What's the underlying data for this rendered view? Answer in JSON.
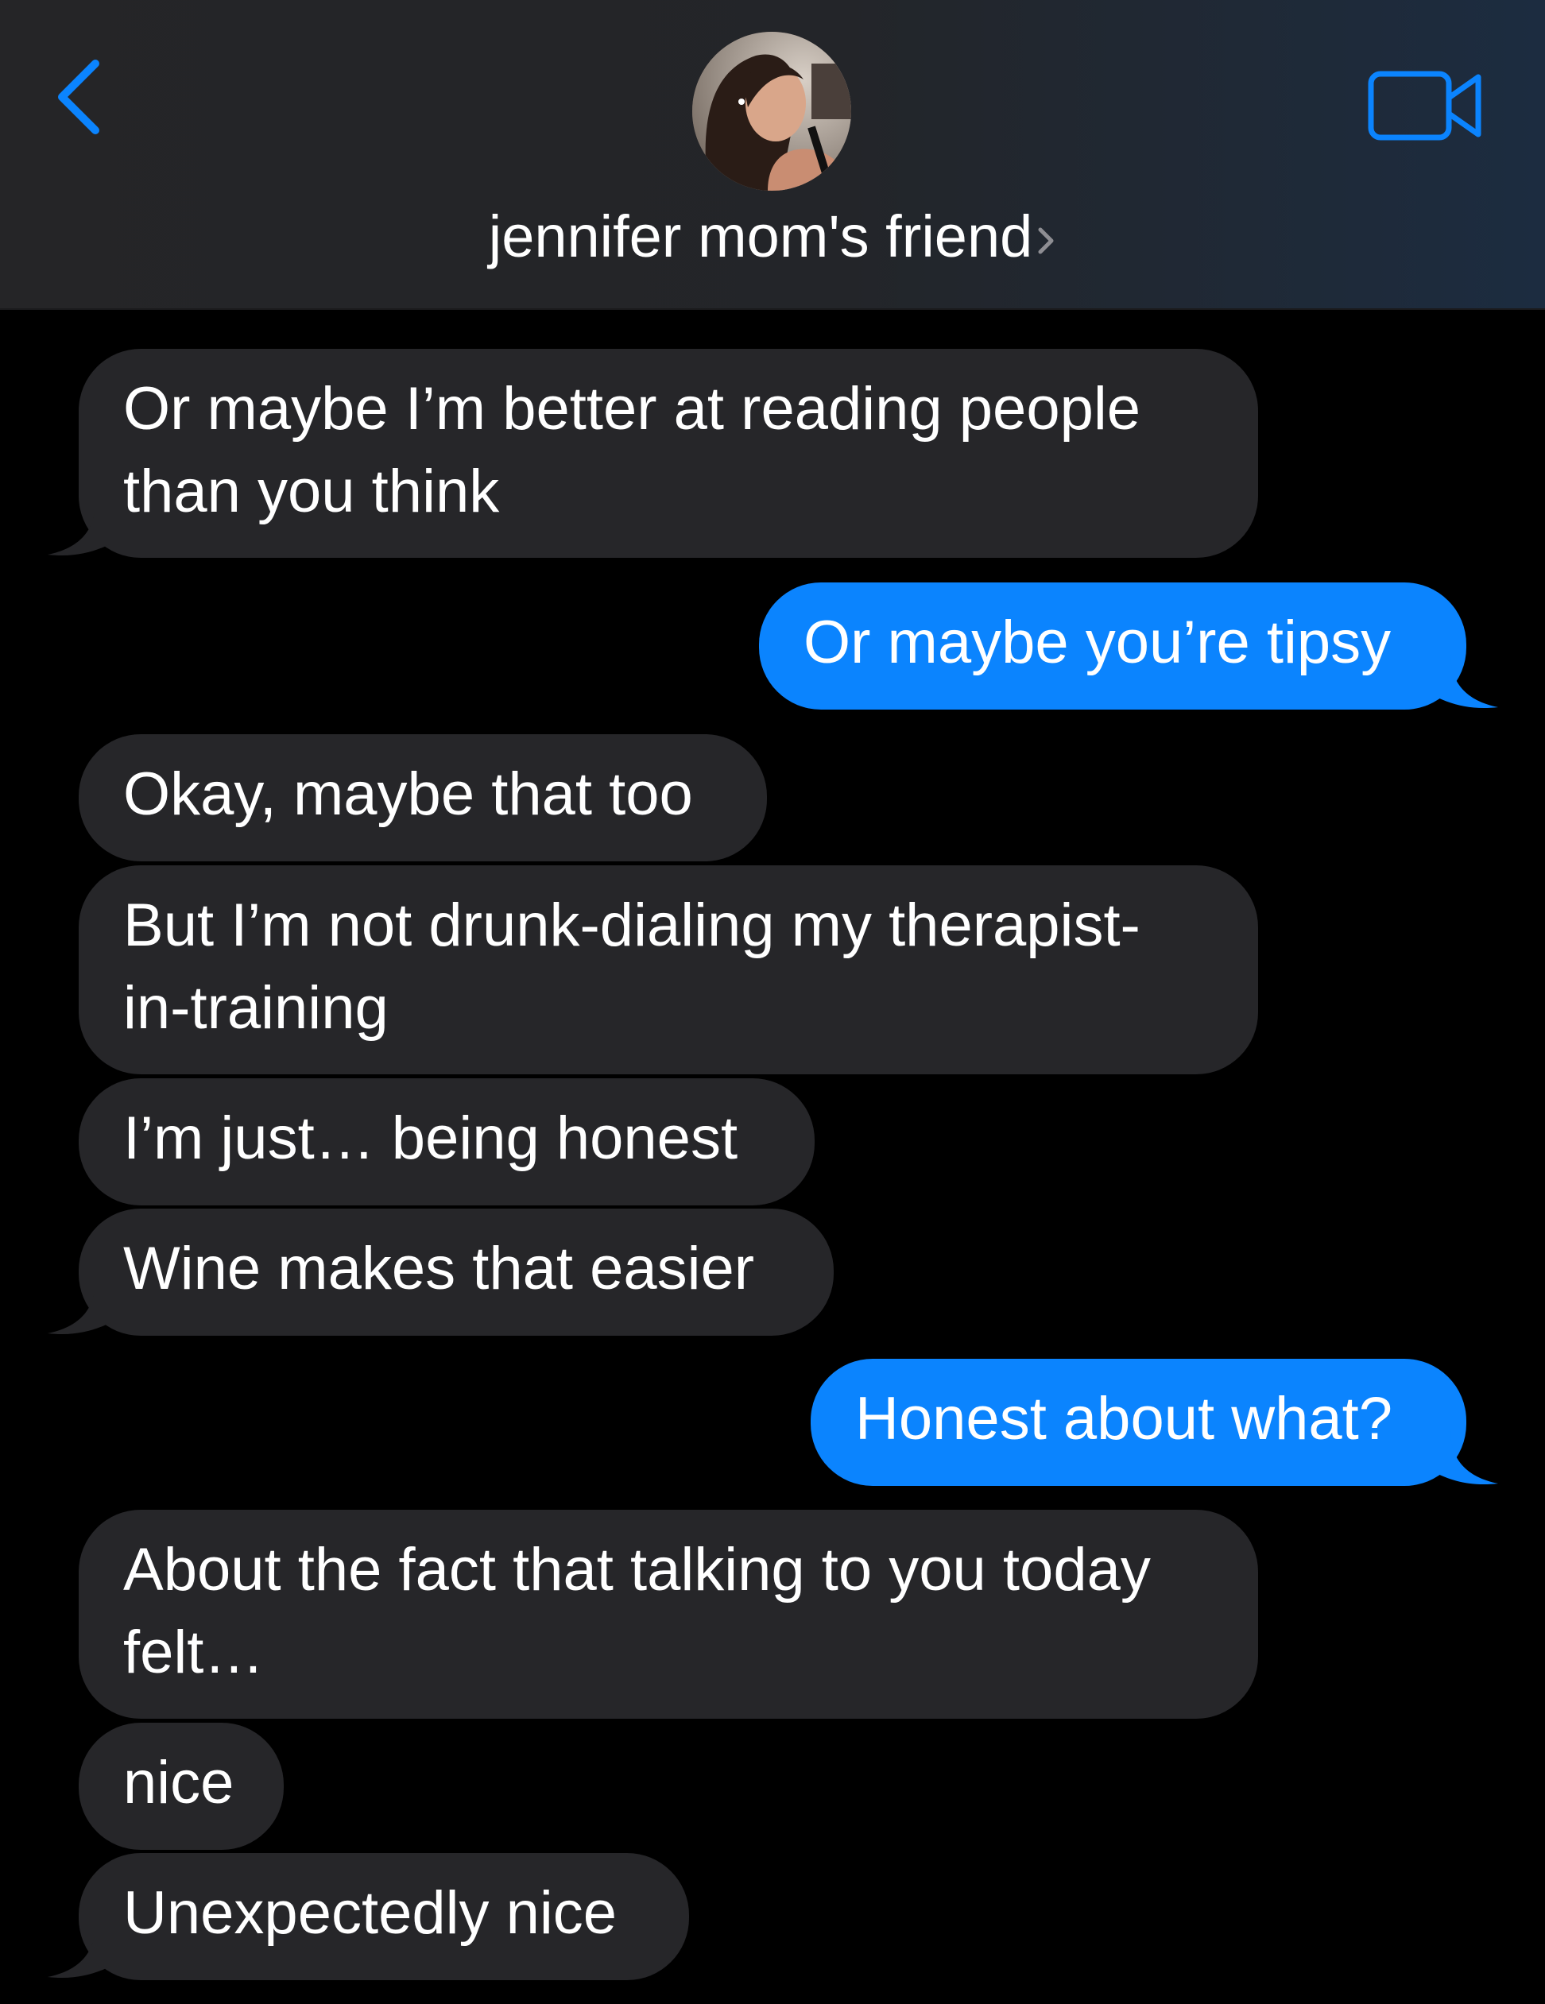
{
  "header": {
    "back_icon": "chevron-left-icon",
    "contact_name": "jennifer mom's friend",
    "video_icon": "video-camera-icon",
    "accent_color": "#0b84fe"
  },
  "messages": [
    {
      "side": "received",
      "lines": [
        "Or maybe I’m better at reading people",
        "than you think"
      ],
      "tail": true
    },
    {
      "side": "sent",
      "lines": [
        "Or maybe you’re tipsy"
      ],
      "tail": true
    },
    {
      "side": "received",
      "lines": [
        "Okay, maybe that too"
      ],
      "tail": false
    },
    {
      "side": "received",
      "lines": [
        "But I’m not drunk-dialing my therapist-",
        "in-training"
      ],
      "tail": false
    },
    {
      "side": "received",
      "lines": [
        "I’m just… being honest"
      ],
      "tail": false
    },
    {
      "side": "received",
      "lines": [
        "Wine makes that easier"
      ],
      "tail": true
    },
    {
      "side": "sent",
      "lines": [
        "Honest about what?"
      ],
      "tail": true
    },
    {
      "side": "received",
      "lines": [
        "About the fact that talking to you today",
        "felt…"
      ],
      "tail": false
    },
    {
      "side": "received",
      "lines": [
        "nice"
      ],
      "tail": false
    },
    {
      "side": "received",
      "lines": [
        "Unexpectedly nice"
      ],
      "tail": true
    }
  ]
}
